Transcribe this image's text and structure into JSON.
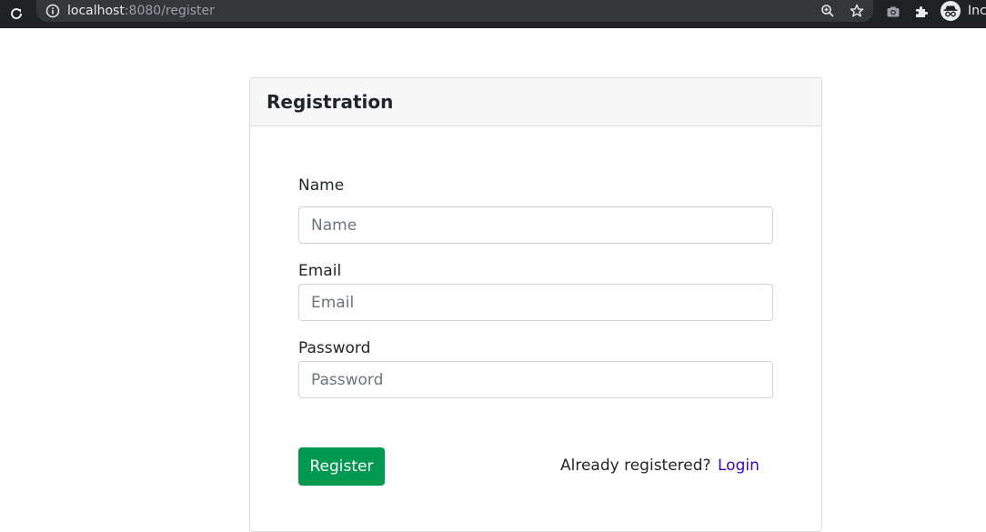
{
  "browser": {
    "url_host": "localhost",
    "url_rest": ":8080/register",
    "incognito_label": "Inc",
    "icons": {
      "reload": "reload-icon",
      "info": "info-icon",
      "zoom": "zoom-icon",
      "bookmark": "star-icon",
      "extension_camera": "camera-icon",
      "extensions": "puzzle-icon",
      "incognito": "incognito-icon"
    }
  },
  "card": {
    "title": "Registration"
  },
  "form": {
    "name": {
      "label": "Name",
      "placeholder": "Name",
      "value": ""
    },
    "email": {
      "label": "Email",
      "placeholder": "Email",
      "value": ""
    },
    "password": {
      "label": "Password",
      "placeholder": "Password",
      "value": ""
    },
    "submit_label": "Register",
    "already_text": "Already registered?",
    "login_link": "Login"
  },
  "colors": {
    "browser_bg": "#202124",
    "omnibox_bg": "#35363a",
    "header_bg": "#f7f7f7",
    "register_button": "#009950",
    "login_link": "#3b00e0"
  }
}
